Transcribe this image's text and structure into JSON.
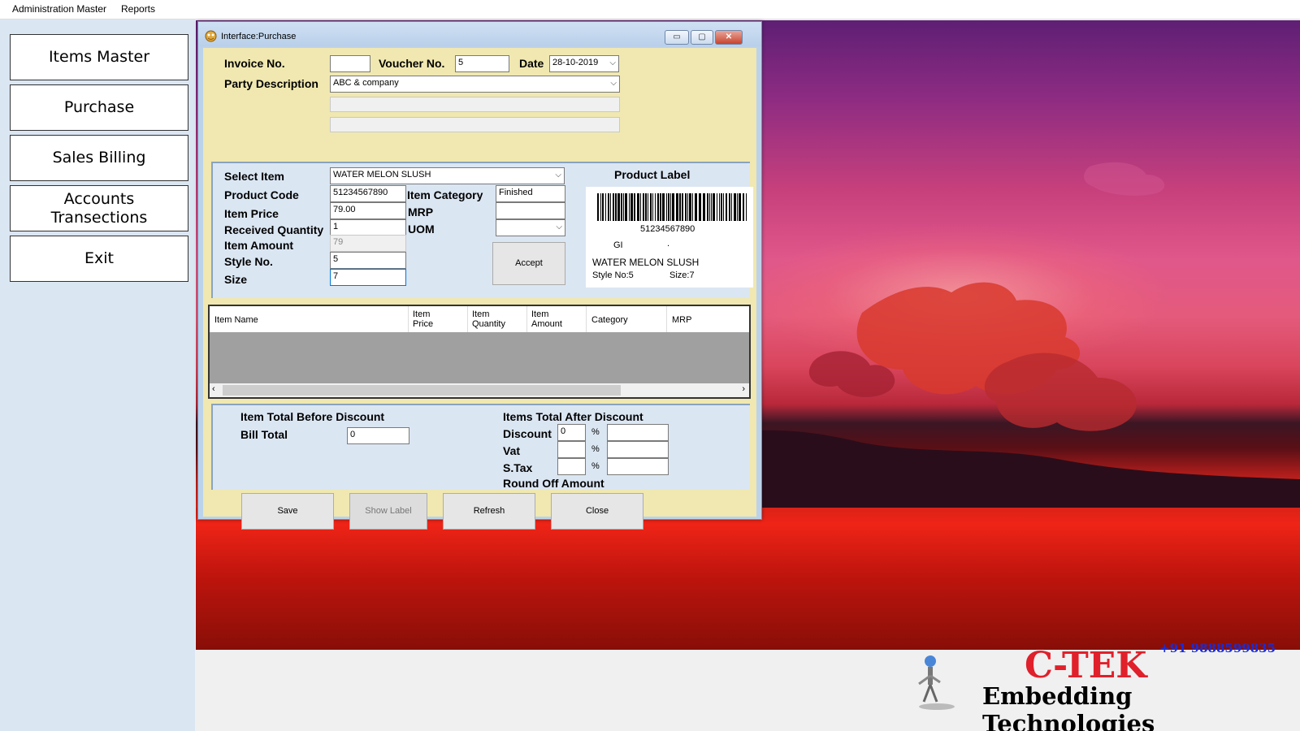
{
  "menu": {
    "items": [
      "Administration Master",
      "Reports"
    ]
  },
  "nav": {
    "items": [
      "Items Master",
      "Purchase",
      "Sales Billing",
      "Accounts\nTransections",
      "Exit"
    ]
  },
  "window": {
    "title": "Interface:Purchase",
    "min": "▭",
    "max": "▢",
    "close": "✕"
  },
  "header": {
    "invoice_label": "Invoice No.",
    "invoice_value": "",
    "voucher_label": "Voucher No.",
    "voucher_value": "5",
    "date_label": "Date",
    "date_value": "28-10-2019",
    "party_label": "Party Description",
    "party_value": "ABC & company"
  },
  "item": {
    "select_label": "Select Item",
    "select_value": "WATER MELON SLUSH",
    "code_label": "Product Code",
    "code_value": "51234567890",
    "price_label": "Item Price",
    "price_value": "79.00",
    "qty_label": "Received Quantity",
    "qty_value": "1",
    "amount_label": "Item Amount",
    "amount_value": "79",
    "style_label": "Style No.",
    "style_value": "5",
    "size_label": "Size",
    "size_value": "7",
    "category_label": "Item  Category",
    "category_value": "Finished",
    "mrp_label": "MRP",
    "mrp_value": "",
    "uom_label": "UOM",
    "uom_value": "",
    "accept_label": "Accept"
  },
  "product_label": {
    "title": "Product Label",
    "barcode_number": "51234567890",
    "gi": "GI",
    "dot": ".",
    "name": "WATER MELON SLUSH",
    "style": "Style No:5",
    "size": "Size:7"
  },
  "grid": {
    "columns": [
      "Item Name",
      "Item\nPrice",
      "Item\nQuantity",
      "Item\nAmount",
      "Category",
      "MRP"
    ]
  },
  "totals": {
    "before_label": "Item Total Before Discount",
    "bill_label": "Bill Total",
    "bill_value": "0",
    "after_label": "Items Total After Discount",
    "discount_label": "Discount",
    "discount_value": "0",
    "vat_label": "Vat",
    "stax_label": "S.Tax",
    "round_label": "Round Off Amount",
    "percent": "%"
  },
  "actions": {
    "save": "Save",
    "show_label": "Show Label",
    "refresh": "Refresh",
    "close": "Close"
  },
  "brand": {
    "name": "C-TEK",
    "tagline": "Embedding  Technologies",
    "phone": "+91 9888599835"
  }
}
